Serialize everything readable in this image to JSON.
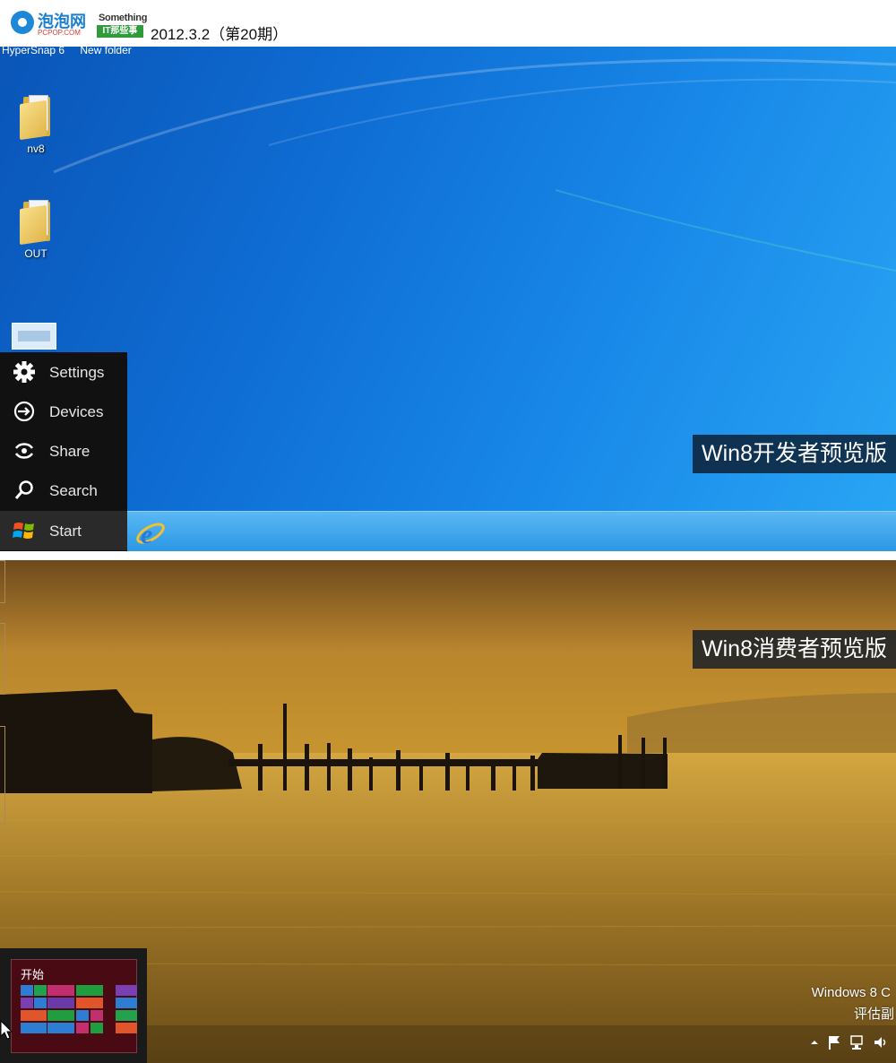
{
  "header": {
    "logo_name": "泡泡网",
    "logo_sub": "PCPOP.COM",
    "column_top": "Something",
    "column_bottom": "IT那些事",
    "issue": "2012.3.2（第20期）"
  },
  "dev_preview": {
    "top_labels": [
      "HyperSnap 6",
      "New folder"
    ],
    "desktop_icons": [
      {
        "label": "nv8",
        "icon": "folder-icon"
      },
      {
        "label": "OUT",
        "icon": "folder-icon"
      }
    ],
    "charms": [
      {
        "label": "Settings",
        "icon": "gear-icon"
      },
      {
        "label": "Devices",
        "icon": "devices-icon"
      },
      {
        "label": "Share",
        "icon": "share-icon"
      },
      {
        "label": "Search",
        "icon": "search-icon"
      },
      {
        "label": "Start",
        "icon": "windows-logo-icon"
      }
    ],
    "taskbar_apps": [
      "internet-explorer-icon"
    ],
    "caption": "Win8开发者预览版"
  },
  "consumer_preview": {
    "caption": "Win8消费者预览版",
    "start_tip_label": "开始",
    "watermark_line1": "Windows 8 C",
    "watermark_line2": "评估副",
    "tray_icons": [
      "show-hidden-icons-arrow",
      "action-center-flag-icon",
      "network-icon",
      "volume-icon"
    ]
  },
  "colors": {
    "dev_desktop": "#1476d8",
    "charms_bg": "#111111",
    "consumer_sky": "#b9852e",
    "start_tile_bg": "#4a0a14"
  }
}
